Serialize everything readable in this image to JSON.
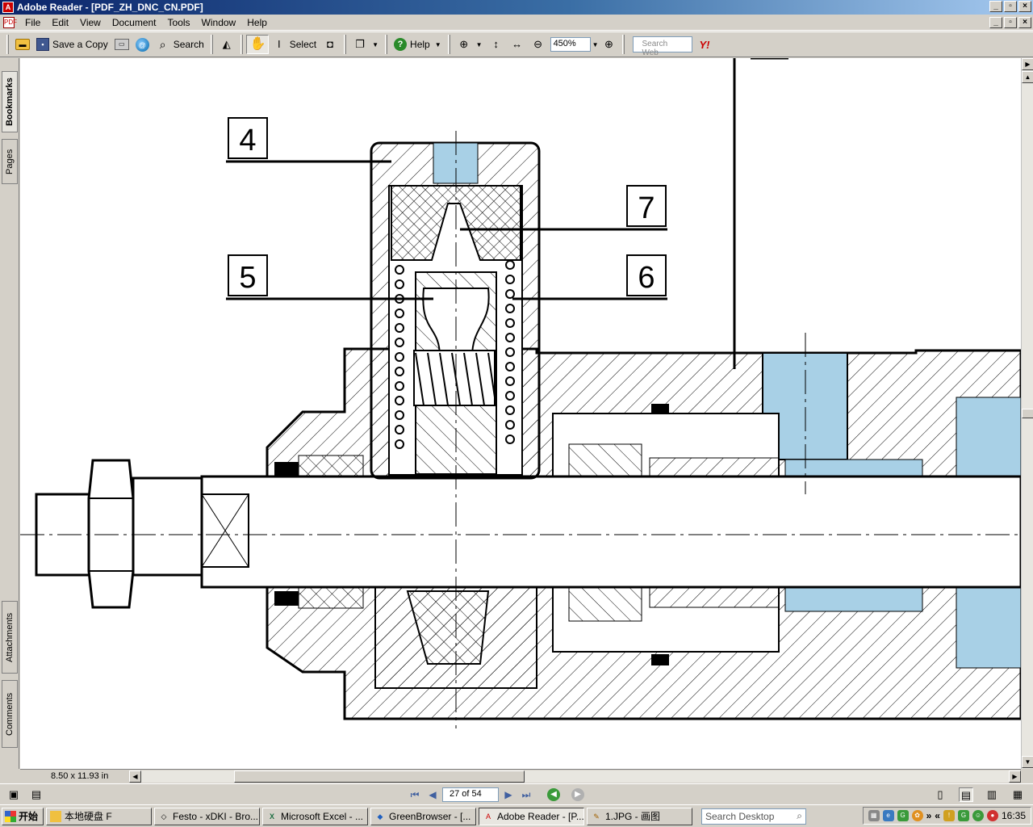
{
  "window": {
    "title": "Adobe Reader - [PDF_ZH_DNC_CN.PDF]"
  },
  "menu": [
    "File",
    "Edit",
    "View",
    "Document",
    "Tools",
    "Window",
    "Help"
  ],
  "toolbar": {
    "save_copy": "Save a Copy",
    "search": "Search",
    "select": "Select",
    "help": "Help",
    "zoom": "450%",
    "search_web_placeholder": "Search Web",
    "yahoo": "Y!"
  },
  "side_tabs": {
    "bookmarks": "Bookmarks",
    "pages": "Pages",
    "attachments": "Attachments",
    "comments": "Comments"
  },
  "drawing": {
    "callouts": [
      "4",
      "7",
      "5",
      "6"
    ],
    "colors": {
      "blue": "#a8d0e6",
      "line": "#000000"
    }
  },
  "status": {
    "page_size": "8.50 x 11.93 in",
    "page": "27 of 54"
  },
  "taskbar": {
    "start": "开始",
    "tasks": [
      "本地硬盘 F",
      "Festo - xDKI - Bro...",
      "Microsoft Excel - ...",
      "GreenBrowser - [...",
      "Adobe Reader - [P...",
      "1.JPG - 画图"
    ],
    "search_desktop": "Search Desktop",
    "clock": "16:35"
  }
}
